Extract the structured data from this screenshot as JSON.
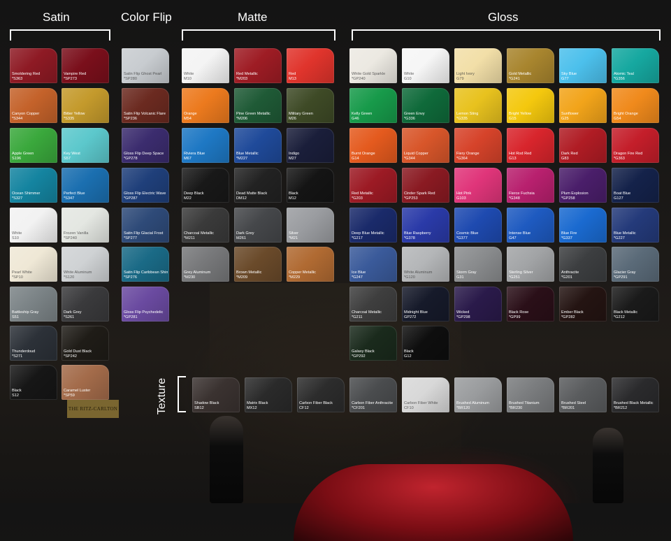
{
  "categories": [
    {
      "label": "Satin",
      "x": 0
    },
    {
      "label": "Color Flip"
    },
    {
      "label": "Matte"
    },
    {
      "label": "Gloss"
    }
  ],
  "texture_label": "Texture",
  "background_sign": "THE RITZ-CARLTON",
  "swatches": [
    {
      "name": "Smoldering Red",
      "code": "*S363",
      "color": "#8e1a24",
      "tone": "dark"
    },
    {
      "name": "Vampire Red",
      "code": "*SP273",
      "color": "#7a0f1b",
      "tone": "dark"
    },
    {
      "name": "Canyon Copper",
      "code": "*S344",
      "color": "#c4622a",
      "tone": "dark"
    },
    {
      "name": "Bitter Yellow",
      "code": "*S335",
      "color": "#c49a2c",
      "tone": "dark"
    },
    {
      "name": "Apple Green",
      "code": "S196",
      "color": "#3aa83c",
      "tone": "dark"
    },
    {
      "name": "Key West",
      "code": "S57",
      "color": "#5cc8cc",
      "tone": "dark"
    },
    {
      "name": "Ocean Shimmer",
      "code": "*S327",
      "color": "#1484a0",
      "tone": "dark"
    },
    {
      "name": "Perfect Blue",
      "code": "*S347",
      "color": "#1b6fb0",
      "tone": "dark"
    },
    {
      "name": "White",
      "code": "S10",
      "color": "#f2f2f2",
      "tone": "light"
    },
    {
      "name": "Frozen Vanilla",
      "code": "*SP240",
      "color": "#e4e7e2",
      "tone": "light"
    },
    {
      "name": "Pearl White",
      "code": "*SP10",
      "color": "#efe8d6",
      "tone": "light"
    },
    {
      "name": "White Aluminum",
      "code": "*S120",
      "color": "#cfd2d4",
      "tone": "light"
    },
    {
      "name": "Battleship Gray",
      "code": "S51",
      "color": "#7b8386",
      "tone": "dark"
    },
    {
      "name": "Dark Grey",
      "code": "*S261",
      "color": "#3a3a3c",
      "tone": "dark"
    },
    {
      "name": "Thunderdoud",
      "code": "*S271",
      "color": "#2c3138",
      "tone": "dark"
    },
    {
      "name": "Gold Dust Black",
      "code": "*SP242",
      "color": "#1f1c17",
      "tone": "dark"
    },
    {
      "name": "Black",
      "code": "S12",
      "color": "#161616",
      "tone": "dark"
    },
    {
      "name": "Caramel Luster",
      "code": "*SP59",
      "color": "#a36b4a",
      "tone": "dark"
    },
    {
      "name": "Satin Flip Ghost Pearl",
      "code": "*SP280",
      "color": "#c8ccd0",
      "tone": "light"
    },
    {
      "name": "Satin Flip Volcanic Flare",
      "code": "*SP236",
      "color": "#6b2a20",
      "tone": "dark"
    },
    {
      "name": "Gloss Flip Deep Space",
      "code": "*GP278",
      "color": "#3b2c6e",
      "tone": "dark"
    },
    {
      "name": "Gloss Flip Electric Wave",
      "code": "*GP287",
      "color": "#1f3f7a",
      "tone": "dark"
    },
    {
      "name": "Satin Flip Glacial Frost",
      "code": "*SP277",
      "color": "#2e4a78",
      "tone": "dark"
    },
    {
      "name": "Satin Flip Caribbean Shimmer",
      "code": "*SP276",
      "color": "#1a6a86",
      "tone": "dark"
    },
    {
      "name": "Gloss Flip Psychedelic",
      "code": "*GP281",
      "color": "#6a4aa0",
      "tone": "dark"
    },
    {
      "name": "White",
      "code": "M10",
      "color": "#f4f4f4",
      "tone": "light"
    },
    {
      "name": "Red Metallic",
      "code": "*M203",
      "color": "#9e1c24",
      "tone": "dark"
    },
    {
      "name": "Red",
      "code": "M13",
      "color": "#e0342c",
      "tone": "dark"
    },
    {
      "name": "Orange",
      "code": "M54",
      "color": "#ec7a1e",
      "tone": "dark"
    },
    {
      "name": "Pine Green Metallic",
      "code": "*M206",
      "color": "#1f5a36",
      "tone": "dark"
    },
    {
      "name": "Military Green",
      "code": "M26",
      "color": "#3e4a26",
      "tone": "dark"
    },
    {
      "name": "Riviera Blue",
      "code": "M67",
      "color": "#1e78c4",
      "tone": "dark"
    },
    {
      "name": "Blue Metallic",
      "code": "*M227",
      "color": "#1f4a9a",
      "tone": "dark"
    },
    {
      "name": "Indigo",
      "code": "M27",
      "color": "#1a1e3a",
      "tone": "dark"
    },
    {
      "name": "Deep Black",
      "code": "M22",
      "color": "#181818",
      "tone": "dark"
    },
    {
      "name": "Dead Matte Black",
      "code": "DM12",
      "color": "#222222",
      "tone": "dark"
    },
    {
      "name": "Black",
      "code": "M12",
      "color": "#141414",
      "tone": "dark"
    },
    {
      "name": "Charcoal Metallic",
      "code": "*M211",
      "color": "#3a3a3a",
      "tone": "dark"
    },
    {
      "name": "Dark Grey",
      "code": "M261",
      "color": "#45474a",
      "tone": "dark"
    },
    {
      "name": "Silver",
      "code": "*M21",
      "color": "#9a9ca0",
      "tone": "dark"
    },
    {
      "name": "Grey Aluminum",
      "code": "*M230",
      "color": "#77787a",
      "tone": "dark"
    },
    {
      "name": "Brown Metallic",
      "code": "*M209",
      "color": "#6a4a2a",
      "tone": "dark"
    },
    {
      "name": "Copper Metallic",
      "code": "*M229",
      "color": "#b06a32",
      "tone": "dark"
    },
    {
      "name": "White Gold Sparkle",
      "code": "*GP240",
      "color": "#ece9e2",
      "tone": "light"
    },
    {
      "name": "White",
      "code": "G10",
      "color": "#f6f6f6",
      "tone": "light"
    },
    {
      "name": "Light Ivory",
      "code": "G79",
      "color": "#f2dfa8",
      "tone": "light"
    },
    {
      "name": "Gold Metallic",
      "code": "*G241",
      "color": "#a8852e",
      "tone": "dark"
    },
    {
      "name": "Sky Blue",
      "code": "G77",
      "color": "#4cc0ec",
      "tone": "dark"
    },
    {
      "name": "Atomic Teal",
      "code": "*G356",
      "color": "#16a8a0",
      "tone": "dark"
    },
    {
      "name": "Kelly Green",
      "code": "G46",
      "color": "#179a4a",
      "tone": "dark"
    },
    {
      "name": "Green Envy",
      "code": "*G336",
      "color": "#0f6a3a",
      "tone": "dark"
    },
    {
      "name": "Lemon Sting",
      "code": "*G335",
      "color": "#e8c21e",
      "tone": "dark"
    },
    {
      "name": "Bright Yellow",
      "code": "G15",
      "color": "#f4c80e",
      "tone": "dark"
    },
    {
      "name": "Sunflower",
      "code": "G25",
      "color": "#f2a41a",
      "tone": "dark"
    },
    {
      "name": "Bright Orange",
      "code": "G54",
      "color": "#f08a1c",
      "tone": "dark"
    },
    {
      "name": "Burnt Orange",
      "code": "G14",
      "color": "#e45a1e",
      "tone": "dark"
    },
    {
      "name": "Liquid Copper",
      "code": "*G344",
      "color": "#d8562a",
      "tone": "dark"
    },
    {
      "name": "Fiery Orange",
      "code": "*G364",
      "color": "#d6432a",
      "tone": "dark"
    },
    {
      "name": "Hot Rod Red",
      "code": "G13",
      "color": "#d8252c",
      "tone": "dark"
    },
    {
      "name": "Dark Red",
      "code": "G83",
      "color": "#b01c24",
      "tone": "dark"
    },
    {
      "name": "Dragon Fire Red",
      "code": "*G363",
      "color": "#c41e2a",
      "tone": "dark"
    },
    {
      "name": "Red Metallic",
      "code": "*G203",
      "color": "#9c1a24",
      "tone": "dark"
    },
    {
      "name": "Cinder Spark Red",
      "code": "*GP253",
      "color": "#8a1a22",
      "tone": "dark"
    },
    {
      "name": "Hot Pink",
      "code": "G103",
      "color": "#e0357a",
      "tone": "dark"
    },
    {
      "name": "Fierce Fuchsia",
      "code": "*G348",
      "color": "#b8206e",
      "tone": "dark"
    },
    {
      "name": "Plum Explosion",
      "code": "*GP258",
      "color": "#4a1e6a",
      "tone": "dark"
    },
    {
      "name": "Boat Blue",
      "code": "G127",
      "color": "#14224a",
      "tone": "dark"
    },
    {
      "name": "Deep Blue Metallic",
      "code": "*G217",
      "color": "#1a2a6a",
      "tone": "dark"
    },
    {
      "name": "Blue Raspberry",
      "code": "*G378",
      "color": "#2a3aa8",
      "tone": "dark"
    },
    {
      "name": "Cosmic Blue",
      "code": "*G377",
      "color": "#1e4ab0",
      "tone": "dark"
    },
    {
      "name": "Intense Blue",
      "code": "G47",
      "color": "#1e5ac0",
      "tone": "dark"
    },
    {
      "name": "Blue Fire",
      "code": "*G337",
      "color": "#1a6ad0",
      "tone": "dark"
    },
    {
      "name": "Blue Metallic",
      "code": "*G227",
      "color": "#243a7a",
      "tone": "dark"
    },
    {
      "name": "Ice Blue",
      "code": "*G247",
      "color": "#3a5a9a",
      "tone": "dark"
    },
    {
      "name": "White Aluminum",
      "code": "*G120",
      "color": "#b4b6b8",
      "tone": "light"
    },
    {
      "name": "Storm Gray",
      "code": "G31",
      "color": "#8a8c8e",
      "tone": "dark"
    },
    {
      "name": "Sterling Silver",
      "code": "*G251",
      "color": "#a2a4a6",
      "tone": "dark"
    },
    {
      "name": "Anthracite",
      "code": "*G201",
      "color": "#3c3e40",
      "tone": "dark"
    },
    {
      "name": "Glacier Gray",
      "code": "*GP291",
      "color": "#5a6a78",
      "tone": "dark"
    },
    {
      "name": "Charcoal Metallic",
      "code": "*G211",
      "color": "#3e3e3e",
      "tone": "dark"
    },
    {
      "name": "Midnight Blue",
      "code": "GP272",
      "color": "#161a2a",
      "tone": "dark"
    },
    {
      "name": "Wicked",
      "code": "*GP298",
      "color": "#2a1a4a",
      "tone": "dark"
    },
    {
      "name": "Black Rose",
      "code": "*GP99",
      "color": "#2a0f18",
      "tone": "dark"
    },
    {
      "name": "Ember Black",
      "code": "*GP282",
      "color": "#241412",
      "tone": "dark"
    },
    {
      "name": "Black Metallic",
      "code": "*G212",
      "color": "#1a1a1a",
      "tone": "dark"
    },
    {
      "name": "Galaxy Black",
      "code": "*GP292",
      "color": "#1a2a1c",
      "tone": "dark"
    },
    {
      "name": "Black",
      "code": "G12",
      "color": "#0e0e0e",
      "tone": "dark"
    },
    {
      "name": "Shadow Black",
      "code": "SB12",
      "color": "#3a3230",
      "tone": "dark"
    },
    {
      "name": "Matrix Black",
      "code": "MX12",
      "color": "#2a2a2a",
      "tone": "dark"
    },
    {
      "name": "Carbon Fiber Black",
      "code": "CF12",
      "color": "#2c2c2c",
      "tone": "dark"
    },
    {
      "name": "Carbon Fiber Anthracite",
      "code": "*CF201",
      "color": "#4a4c4e",
      "tone": "dark"
    },
    {
      "name": "Carbon Fiber White",
      "code": "CF10",
      "color": "#d8d8d8",
      "tone": "light"
    },
    {
      "name": "Brushed Aluminum",
      "code": "*BR120",
      "color": "#9a9c9e",
      "tone": "dark"
    },
    {
      "name": "Brushed Titanium",
      "code": "*BR230",
      "color": "#7a7c7e",
      "tone": "dark"
    },
    {
      "name": "Brushed Steel",
      "code": "*BR201",
      "color": "#5a5c5e",
      "tone": "dark"
    },
    {
      "name": "Brushed Black Metallic",
      "code": "*BR212",
      "color": "#2a2a2c",
      "tone": "dark"
    }
  ]
}
